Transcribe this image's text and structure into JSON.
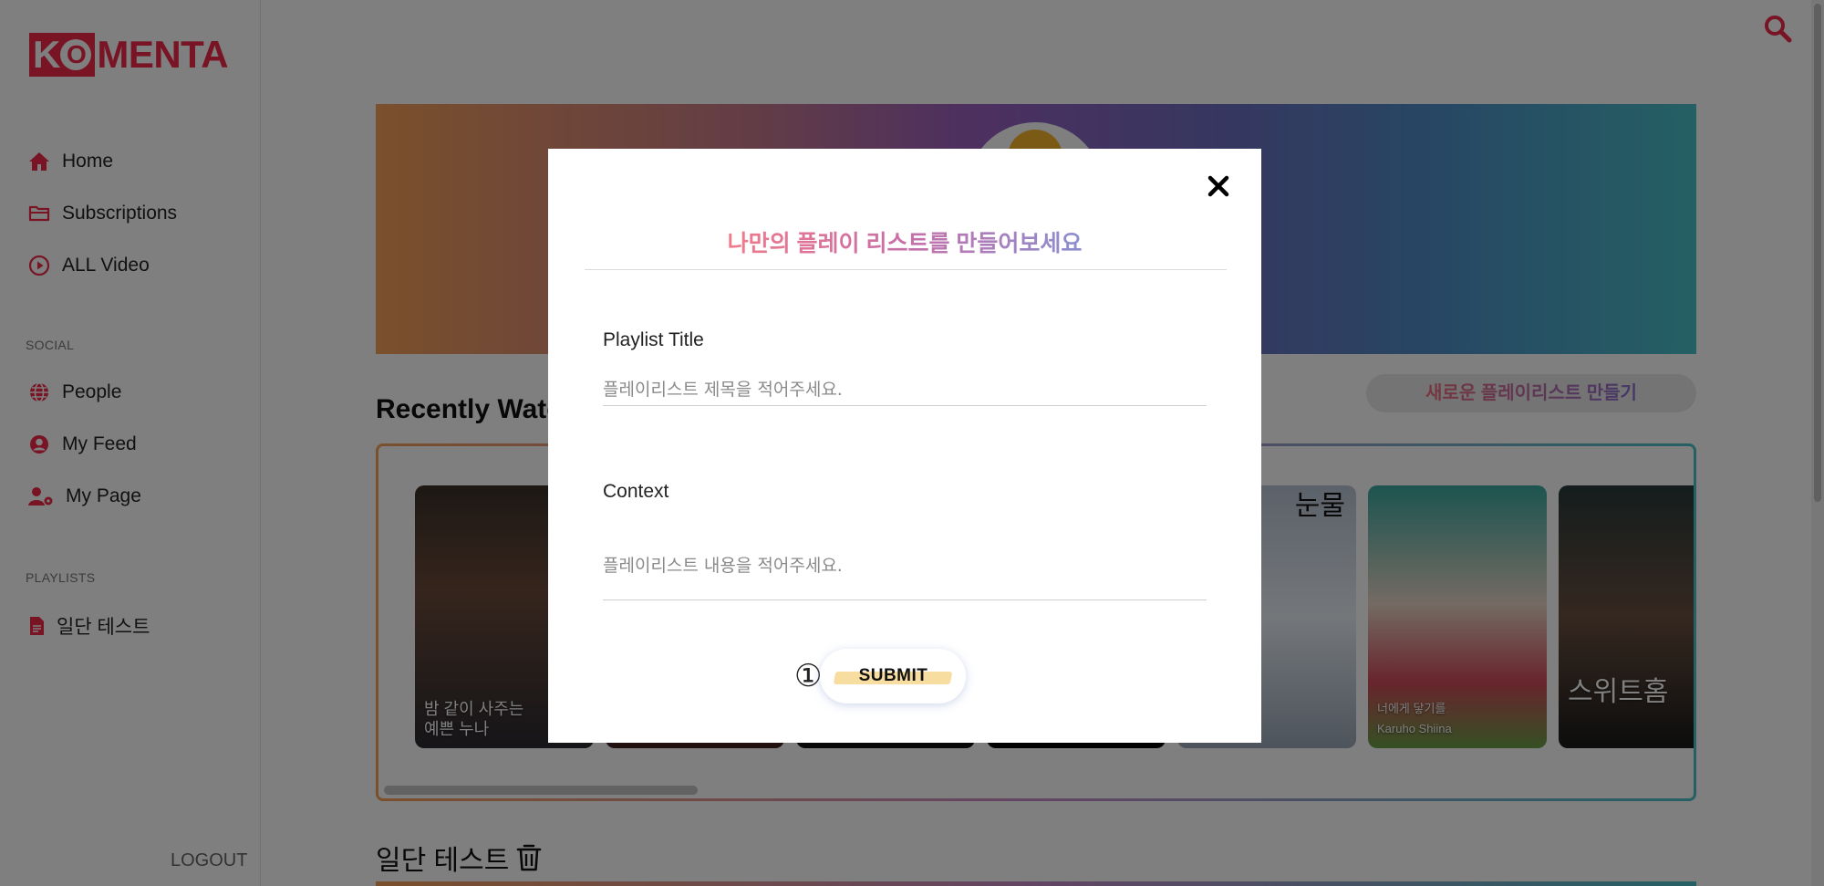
{
  "sidebar": {
    "logo_boxed": "K",
    "logo_o": "O",
    "logo_rest": "MENTA",
    "nav": [
      {
        "label": "Home",
        "icon": "home-icon"
      },
      {
        "label": "Subscriptions",
        "icon": "folder-icon"
      },
      {
        "label": "ALL Video",
        "icon": "play-circle-icon"
      }
    ],
    "social_label": "SOCIAL",
    "social": [
      {
        "label": "People",
        "icon": "globe-icon"
      },
      {
        "label": "My Feed",
        "icon": "user-circle-icon"
      },
      {
        "label": "My Page",
        "icon": "user-gear-icon"
      }
    ],
    "playlists_label": "PLAYLISTS",
    "playlists": [
      {
        "label": "일단 테스트",
        "icon": "file-icon"
      }
    ],
    "logout": "LOGOUT"
  },
  "main": {
    "recent_title": "Recently Watc",
    "new_playlist_button": "새로운 플레이리스트 만들기",
    "posters": [
      {
        "text_line1": "밤 같이 사주는",
        "text_line2": "예쁜 누나"
      },
      {
        "text_line1": "",
        "text_line2": ""
      },
      {
        "text_line1": "",
        "text_line2": ""
      },
      {
        "text_line1": "",
        "text_line2": ""
      },
      {
        "text_line1": "눈물",
        "text_line2": ""
      },
      {
        "text_line1": "너에게 닿기를",
        "text_line2": "Karuho Shiina"
      },
      {
        "text_line1": "스위트홈",
        "text_line2": ""
      }
    ],
    "playlist_heading": "일단 테스트"
  },
  "modal": {
    "title": "나만의 플레이 리스트를 만들어보세요",
    "title_label": "Playlist Title",
    "title_placeholder": "플레이리스트 제목을 적어주세요.",
    "context_label": "Context",
    "context_placeholder": "플레이리스트 내용을 적어주세요.",
    "annotation": "①",
    "submit": "SUBMIT"
  },
  "colors": {
    "brand": "#f02849",
    "modal_title_start": "#f07a8a",
    "modal_title_end": "#8b8fd0",
    "submit_highlight": "#f8dda0"
  }
}
